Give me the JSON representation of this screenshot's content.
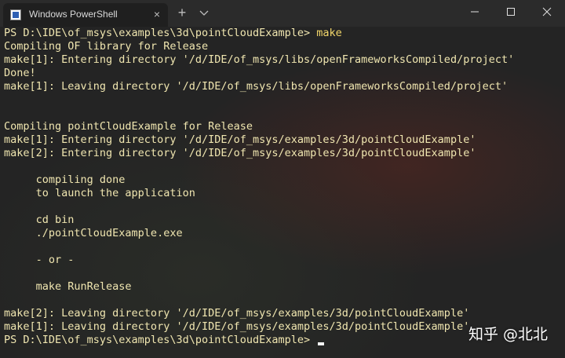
{
  "titlebar": {
    "tab_title": "Windows PowerShell",
    "new_tab_label": "+",
    "close_tab_label": "×"
  },
  "terminal": {
    "prompt": "PS D:\\IDE\\of_msys\\examples\\3d\\pointCloudExample> ",
    "command": "make",
    "lines": [
      "Compiling OF library for Release",
      "make[1]: Entering directory '/d/IDE/of_msys/libs/openFrameworksCompiled/project'",
      "Done!",
      "make[1]: Leaving directory '/d/IDE/of_msys/libs/openFrameworksCompiled/project'",
      "",
      "",
      "Compiling pointCloudExample for Release",
      "make[1]: Entering directory '/d/IDE/of_msys/examples/3d/pointCloudExample'",
      "make[2]: Entering directory '/d/IDE/of_msys/examples/3d/pointCloudExample'",
      "",
      "     compiling done",
      "     to launch the application",
      "",
      "     cd bin",
      "     ./pointCloudExample.exe",
      "",
      "     - or -",
      "",
      "     make RunRelease",
      "",
      "make[2]: Leaving directory '/d/IDE/of_msys/examples/3d/pointCloudExample'",
      "make[1]: Leaving directory '/d/IDE/of_msys/examples/3d/pointCloudExample'"
    ],
    "final_prompt": "PS D:\\IDE\\of_msys\\examples\\3d\\pointCloudExample> "
  },
  "watermark": "知乎 @北北",
  "colors": {
    "text": "#f0e6b0",
    "command": "#f2d66a",
    "background": "#242424",
    "titlebar": "#2b2b2b"
  },
  "icons": {
    "tab_icon": "powershell-icon",
    "dropdown": "chevron-down-icon",
    "minimize": "minimize-icon",
    "maximize": "maximize-icon",
    "close": "close-icon"
  }
}
